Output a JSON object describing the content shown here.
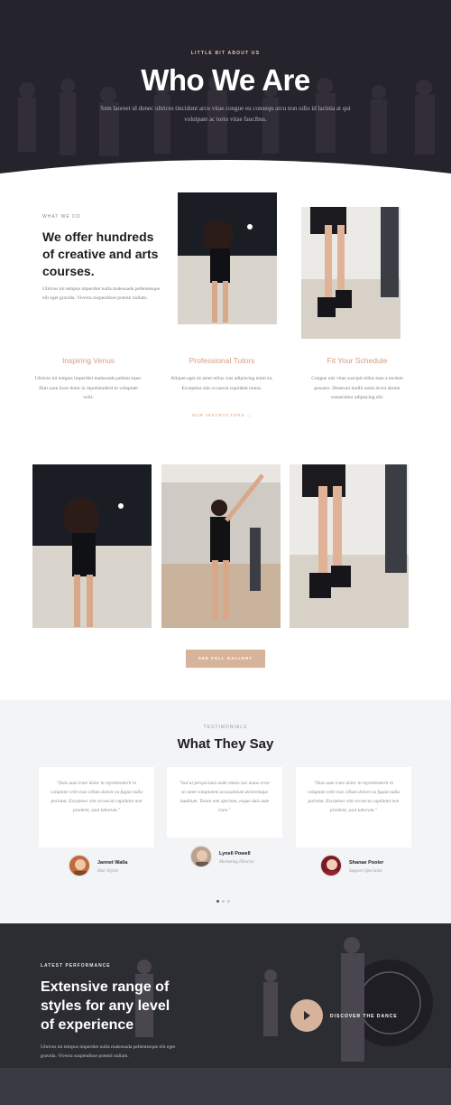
{
  "hero": {
    "eyebrow": "LITTLE BIT ABOUT US",
    "title": "Who We Are",
    "subtitle": "Sem laoreet id donec ultrices tincidunt arcu vitae congue eu consequ arcu non odio id lacinia at qui volutpate ac torto vitae faucibus."
  },
  "what_we_do": {
    "eyebrow": "WHAT WE DO",
    "title": "We offer hundreds of creative and arts courses.",
    "text": "Ultrices mi tempus imperdiet nulla malesuada pellentesque elit eget gravida. Viverra suspendisse potenti nullam."
  },
  "features": [
    {
      "title": "Inspiring Venus",
      "text": "Ultrices mi tempus imperdiet malesuada pellent eque. Duis aute irure dolor in reprehenderit in voluptate velit."
    },
    {
      "title": "Professional Tutors",
      "text": "Aliquet eget sit amet tellus cras adipiscing enim eu. Excepteur sint occaecat cupidatat nonos."
    },
    {
      "title": "Fit Your Schedule",
      "text": "Congue nisi vitae suscipit tellus esse a tordum posuere. Deserunt mollit anim id est abrum consectetur adipiscing elit."
    }
  ],
  "instructors_link": "OUR INSTRUCTORS →",
  "gallery_button": "SEE FULL GALLERY",
  "testimonials": {
    "eyebrow": "TESTIMONIALS",
    "title": "What They Say",
    "items": [
      {
        "quote": "\"Duis aute irure dolor in reprehenderit in voluptate velit esse cillum dolore eu fugiat nulla pariatur. Excepteur sint occaecat cupidatat non proident, sunt laborum.\"",
        "name": "Jannet Walla",
        "role": "Hair Stylist"
      },
      {
        "quote": "\"Sed ut perspiciatis unde omnis iste natus error sit amet voluptatem accusantium doloremque laudtium. Totam rem aperiam, eaque duis aute irure.\"",
        "name": "Lynell Powell",
        "role": "Marketing Director"
      },
      {
        "quote": "\"Duis aute irure dolor in reprehenderit in voluptate velit esse cillum dolore eu fugiat nulla pariatur. Excepteur sint occaecat cupidatat non proident, sunt laborum.\"",
        "name": "Shanae Pooler",
        "role": "Support Specialist"
      }
    ]
  },
  "performance": {
    "eyebrow": "LATEST PERFORMANCE",
    "title": "Extensive range of styles for any level of experience",
    "text": "Ultrices mi tempus imperdiet nulla malesuada pellentesque elit eget gravida. Viverra suspendisse potenti nullam.",
    "play_label": "DISCOVER THE DANCE"
  },
  "colors": {
    "accent": "#d8b39c",
    "accent_text": "#d49c7f",
    "dark": "#25232b",
    "light_bg": "#f3f4f6"
  }
}
